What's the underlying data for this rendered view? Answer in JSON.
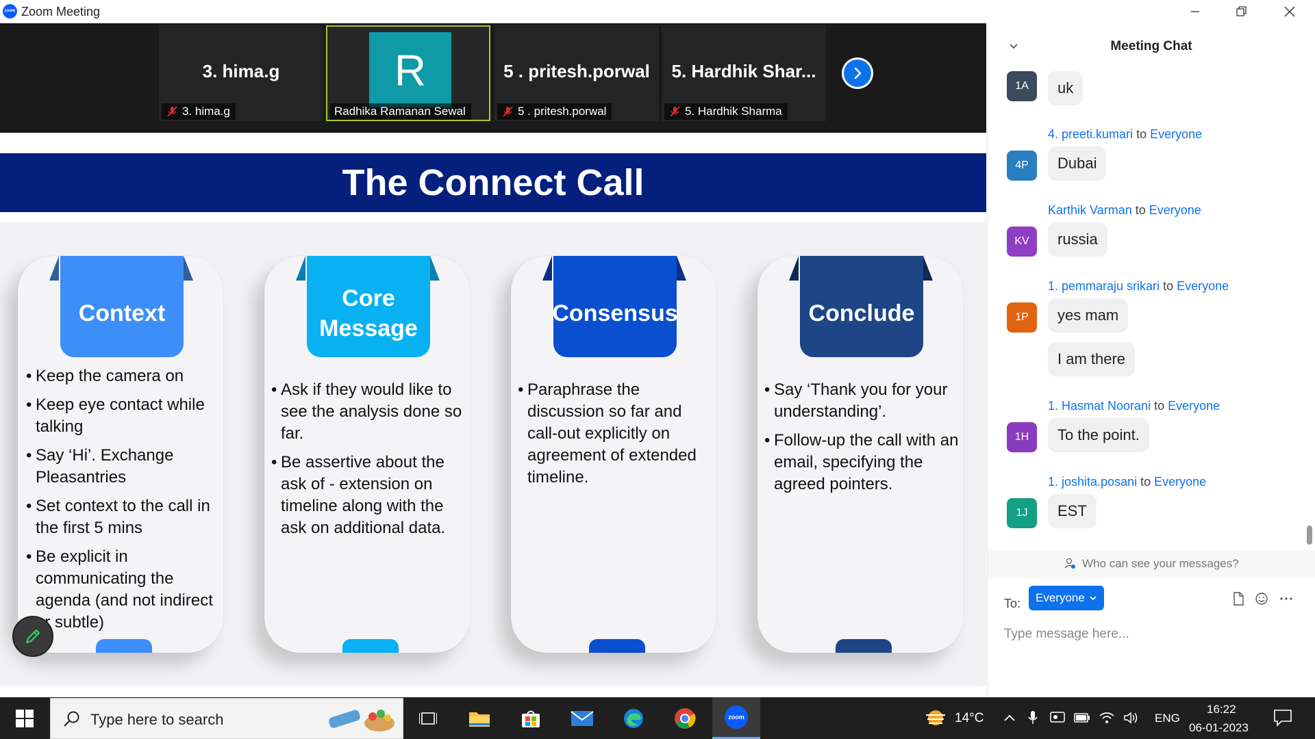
{
  "window": {
    "title": "Zoom Meeting",
    "logo_text": "zoom",
    "colors": {
      "accent": "#0e72ed",
      "titlebar": "#ffffff"
    }
  },
  "participants": [
    {
      "tile_name": "3. hima.g",
      "label": "3. hima.g",
      "muted": true
    },
    {
      "tile_name": "",
      "avatar_letter": "R",
      "label": "Radhika Ramanan Sewal",
      "muted": false,
      "active_speaker": true
    },
    {
      "tile_name": "5 . pritesh.porwal",
      "label": "5 . pritesh.porwal",
      "muted": true
    },
    {
      "tile_name": "5. Hardhik Shar...",
      "label": "5. Hardhik Sharma",
      "muted": true
    }
  ],
  "slide": {
    "title": "The Connect Call",
    "cards": [
      {
        "heading": "Context",
        "color": "#3d8ef8",
        "bullets": [
          "Keep the camera on",
          "Keep eye contact while talking",
          "Say ‘Hi’. Exchange Pleasantries",
          "Set context to the call in the first 5 mins",
          "Be explicit in communicating the agenda (and not indirect or subtle)"
        ]
      },
      {
        "heading": "Core Message",
        "color": "#08b2f2",
        "bullets": [
          "Ask if they would like to see the analysis done so far.",
          "Be assertive about the ask of - extension on timeline along with the ask on additional data."
        ]
      },
      {
        "heading": "Consensus",
        "color": "#0a4fcf",
        "bullets": [
          "Paraphrase the discussion so far and call-out explicitly on agreement of extended timeline."
        ]
      },
      {
        "heading": "Conclude",
        "color": "#1e4585",
        "bullets": [
          "Say ‘Thank you for your understanding’.",
          "Follow-up the call with an email, specifying the agreed pointers."
        ]
      }
    ]
  },
  "chat": {
    "title": "Meeting Chat",
    "messages": [
      {
        "initials": "1A",
        "avatar_color": "#3b4a5e",
        "sender": "",
        "to": "",
        "connector": "",
        "texts": [
          "uk"
        ]
      },
      {
        "initials": "4P",
        "avatar_color": "#2a7fc0",
        "sender": "4. preeti.kumari",
        "connector": "to",
        "to": "Everyone",
        "texts": [
          "Dubai"
        ]
      },
      {
        "initials": "KV",
        "avatar_color": "#8f3fc4",
        "sender": "Karthik Varman",
        "connector": "to",
        "to": "Everyone",
        "texts": [
          "russia"
        ]
      },
      {
        "initials": "1P",
        "avatar_color": "#e06410",
        "sender": "1. pemmaraju srikari",
        "connector": "to",
        "to": "Everyone",
        "texts": [
          "yes mam",
          "I am there"
        ]
      },
      {
        "initials": "1H",
        "avatar_color": "#8b3bbd",
        "sender": "1. Hasmat Noorani",
        "connector": "to",
        "to": "Everyone",
        "texts": [
          "To the point."
        ]
      },
      {
        "initials": "1J",
        "avatar_color": "#13a085",
        "sender": "1. joshita.posani",
        "connector": "to",
        "to": "Everyone",
        "texts": [
          "EST"
        ]
      }
    ],
    "privacy_hint": "Who can see your messages?",
    "to_label": "To:",
    "recipient": "Everyone",
    "input_placeholder": "Type message here..."
  },
  "taskbar": {
    "search_placeholder": "Type here to search",
    "apps": [
      "task-view",
      "file-explorer",
      "microsoft-store",
      "mail",
      "edge",
      "chrome",
      "zoom"
    ],
    "zoom_label": "zoom",
    "weather": "14°C",
    "language": "ENG",
    "time": "16:22",
    "date": "06-01-2023"
  }
}
